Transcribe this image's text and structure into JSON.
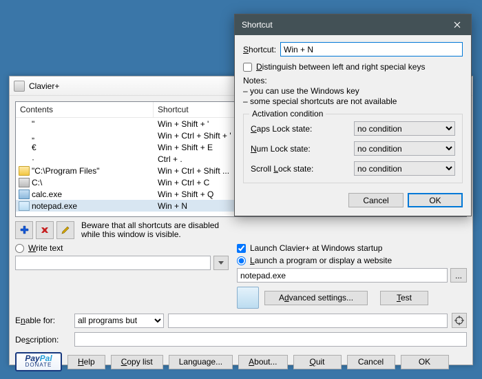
{
  "main": {
    "title": "Clavier+",
    "columns": {
      "contents": "Contents",
      "shortcut": "Shortcut"
    },
    "rows": [
      {
        "icon": "",
        "text": "\"",
        "shortcut": "Win + Shift + '"
      },
      {
        "icon": "",
        "text": "„",
        "shortcut": "Win + Ctrl + Shift + '"
      },
      {
        "icon": "",
        "text": "€",
        "shortcut": "Win + Shift + E"
      },
      {
        "icon": "",
        "text": "·",
        "shortcut": "Ctrl + ."
      },
      {
        "icon": "folder",
        "text": "\"C:\\Program Files\"",
        "shortcut": "Win + Ctrl + Shift ..."
      },
      {
        "icon": "drive",
        "text": "C:\\",
        "shortcut": "Win + Ctrl + C"
      },
      {
        "icon": "calc",
        "text": "calc.exe",
        "shortcut": "Win + Shift + Q"
      },
      {
        "icon": "note",
        "text": "notepad.exe",
        "shortcut": "Win + N",
        "selected": true
      }
    ],
    "warning_l1": "Beware that all shortcuts are disabled",
    "warning_l2": "while this window is visible.",
    "write_text_label": "Write text",
    "launch_startup": "Launch Clavier+ at Windows startup",
    "launch_program_label": "Launch a program or display a website",
    "command_value": "notepad.exe",
    "advanced_btn": "Advanced settings...",
    "test_btn": "Test",
    "enable_for_label": "Enable for:",
    "enable_for_value": "all programs but",
    "description_label": "Description:",
    "paypal_top": "PayPal",
    "paypal_bottom": "DONATE",
    "help_btn": "Help",
    "copy_btn": "Copy list",
    "language_btn": "Language...",
    "about_btn": "About...",
    "quit_btn": "Quit",
    "cancel_btn": "Cancel",
    "ok_btn": "OK",
    "browse_btn": "..."
  },
  "dialog": {
    "title": "Shortcut",
    "shortcut_label": "Shortcut:",
    "shortcut_value": "Win + N",
    "distinguish_label": "Distinguish between left and right special keys",
    "notes_heading": "Notes:",
    "notes_l1": "– you can use the Windows key",
    "notes_l2": "– some special shortcuts are not available",
    "group_title": "Activation condition",
    "caps_label": "Caps Lock state:",
    "num_label": "Num Lock state:",
    "scroll_label": "Scroll Lock state:",
    "no_condition": "no condition",
    "cancel": "Cancel",
    "ok": "OK"
  }
}
